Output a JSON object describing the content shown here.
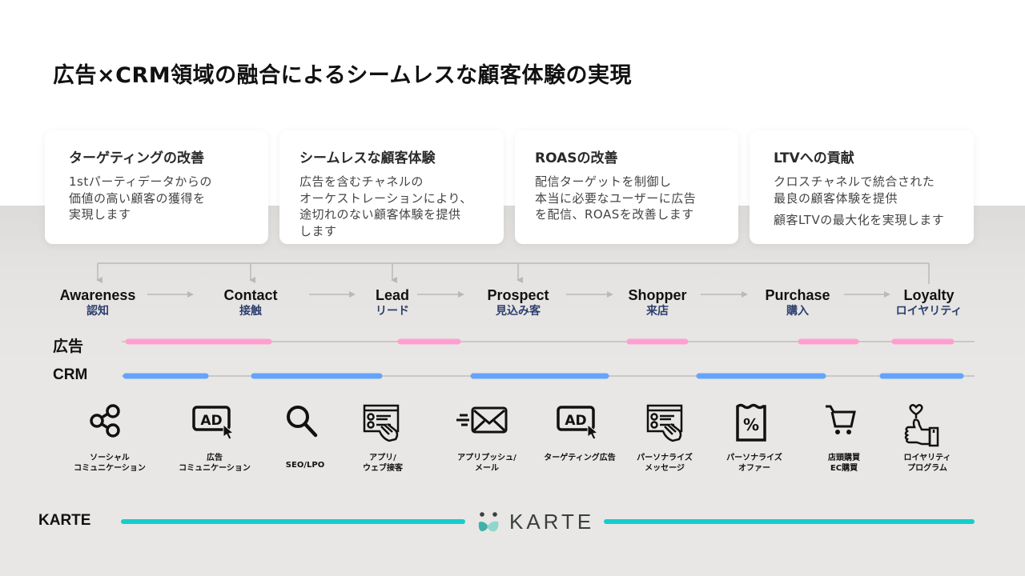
{
  "title": "広告×CRM領域の融合によるシームレスな顧客体験の実現",
  "cards": [
    {
      "title": "ターゲティングの改善",
      "body": "1stパーティデータからの\n価値の高い顧客の獲得を\n実現します",
      "extra": ""
    },
    {
      "title": "シームレスな顧客体験",
      "body": "広告を含むチャネルの\nオーケストレーションにより、\n途切れのない顧客体験を提供\nします",
      "extra": ""
    },
    {
      "title": "ROASの改善",
      "body": "配信ターゲットを制御し\n本当に必要なユーザーに広告\nを配信、ROASを改善します",
      "extra": ""
    },
    {
      "title": "LTVへの貢献",
      "body": "クロスチャネルで統合された\n最良の顧客体験を提供",
      "extra": "顧客LTVの最大化を実現します"
    }
  ],
  "stages": [
    {
      "en": "Awareness",
      "ja": "認知"
    },
    {
      "en": "Contact",
      "ja": "接触"
    },
    {
      "en": "Lead",
      "ja": "リード"
    },
    {
      "en": "Prospect",
      "ja": "見込み客"
    },
    {
      "en": "Shopper",
      "ja": "来店"
    },
    {
      "en": "Purchase",
      "ja": "購入"
    },
    {
      "en": "Loyalty",
      "ja": "ロイヤリティ"
    }
  ],
  "rows": {
    "ad_label": "広告",
    "crm_label": "CRM",
    "ad_color": "#ff9fd0",
    "crm_color": "#66a3fb",
    "track_color": "#bdbdbd"
  },
  "channels": [
    {
      "icon": "share-network-icon",
      "label": "ソーシャル\nコミュニケーション"
    },
    {
      "icon": "ad-click-icon",
      "label": "広告\nコミュニケーション"
    },
    {
      "icon": "search-icon",
      "label": "SEO/LPO"
    },
    {
      "icon": "web-touch-icon",
      "label": "アプリ/\nウェブ接客"
    },
    {
      "icon": "mail-send-icon",
      "label": "アプリプッシュ/\nメール"
    },
    {
      "icon": "ad-click-icon",
      "label": "ターゲティング広告"
    },
    {
      "icon": "web-touch-icon",
      "label": "パーソナライズ\nメッセージ"
    },
    {
      "icon": "coupon-percent-icon",
      "label": "パーソナライズ\nオファー"
    },
    {
      "icon": "shopping-cart-icon",
      "label": "店頭購買\nEC購買"
    },
    {
      "icon": "thumbs-up-heart-icon",
      "label": "ロイヤリティ\nプログラム"
    }
  ],
  "karte": {
    "label": "KARTE",
    "logo_text": "KARTE",
    "line_color": "#12cfcc"
  }
}
